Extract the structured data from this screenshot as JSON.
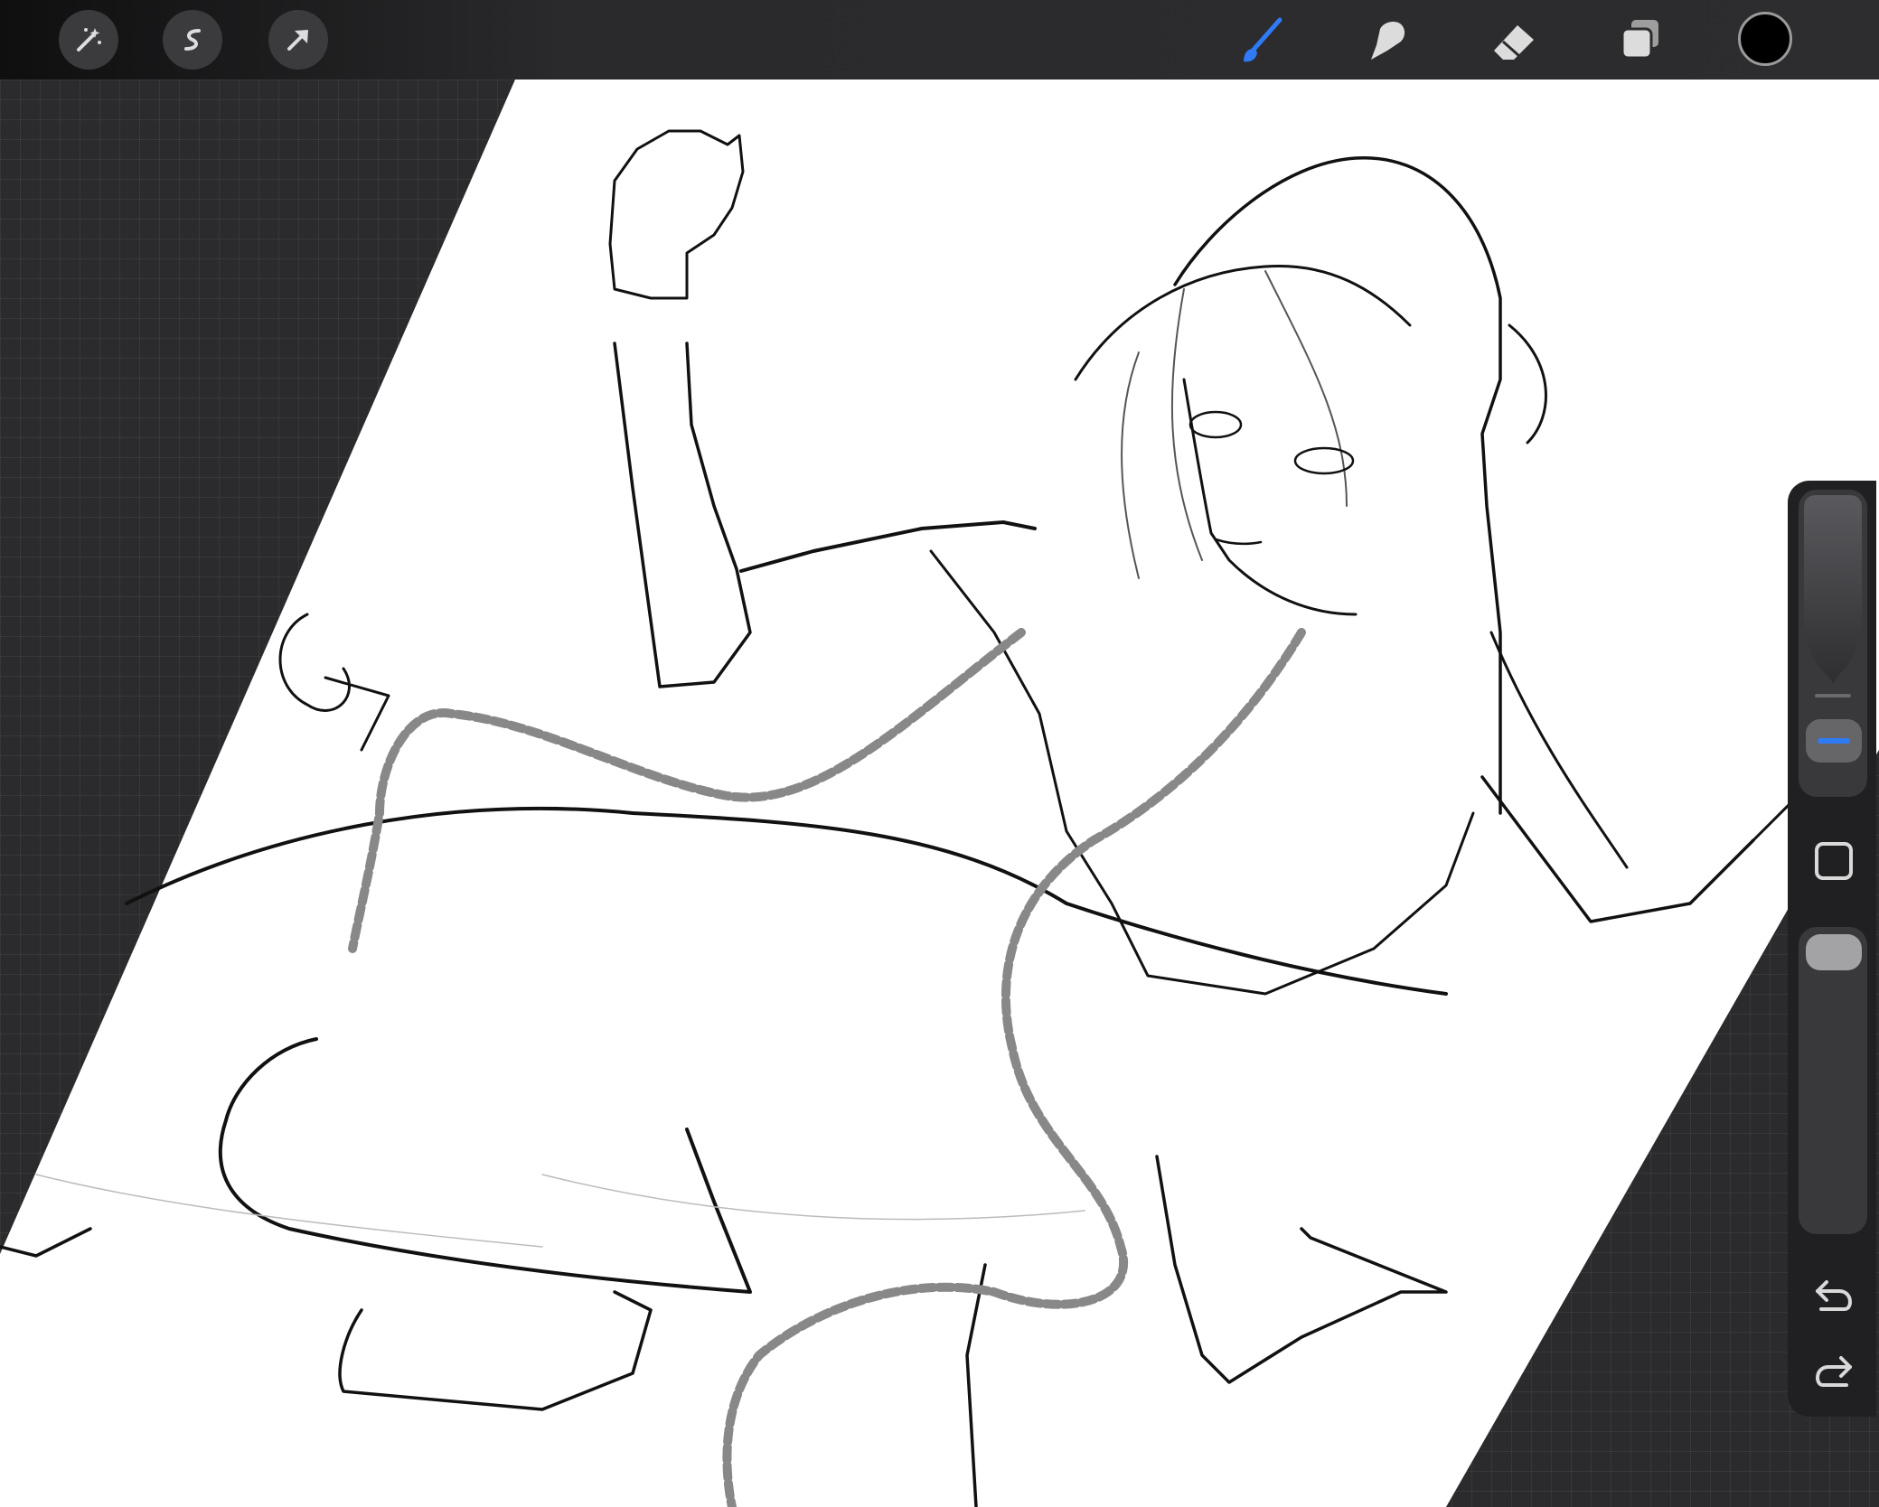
{
  "toolbar": {
    "left_tools": [
      {
        "name": "adjustments",
        "icon": "magic-wand-icon"
      },
      {
        "name": "selection",
        "icon": "s-curve-icon"
      },
      {
        "name": "transform",
        "icon": "arrow-cursor-icon"
      }
    ],
    "right_tools": [
      {
        "name": "brush",
        "icon": "brush-icon",
        "active": true,
        "color": "#2f7bf6"
      },
      {
        "name": "smudge",
        "icon": "smudge-icon",
        "active": false
      },
      {
        "name": "eraser",
        "icon": "eraser-icon",
        "active": false
      },
      {
        "name": "layers",
        "icon": "layers-icon",
        "active": false
      }
    ],
    "current_color": "#000000"
  },
  "sidebar": {
    "brush_size": 0.3,
    "opacity": 1.0,
    "accent": "#2f7bf6",
    "buttons": [
      "modify-square-icon",
      "undo-icon",
      "redo-icon"
    ]
  },
  "canvas": {
    "subject": "line-art sketch",
    "background": "#ffffff"
  }
}
